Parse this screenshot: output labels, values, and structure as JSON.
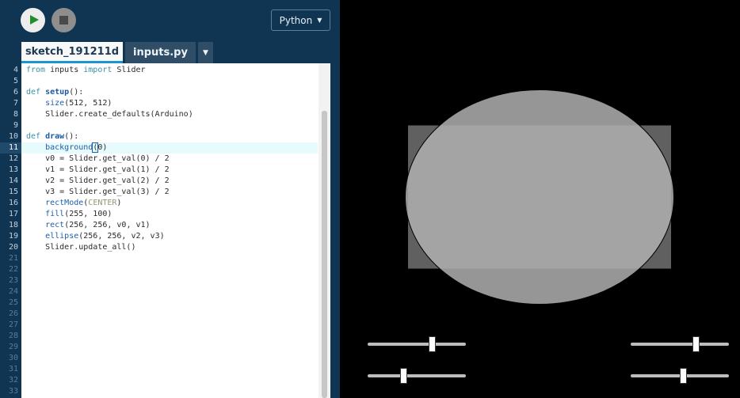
{
  "toolbar": {
    "run_icon": "play-icon",
    "stop_icon": "stop-icon",
    "mode_label": "Python",
    "mode_caret": "▼"
  },
  "tabs": [
    {
      "label": "sketch_191211d",
      "active": true
    },
    {
      "label": "inputs.py",
      "active": false
    }
  ],
  "tab_menu_caret": "▼",
  "editor": {
    "active_line": 11,
    "lines": [
      {
        "num": 4,
        "text": "from inputs import Slider"
      },
      {
        "num": 5,
        "text": ""
      },
      {
        "num": 6,
        "text": "def setup():"
      },
      {
        "num": 7,
        "text": "    size(512, 512)"
      },
      {
        "num": 8,
        "text": "    Slider.create_defaults(Arduino)"
      },
      {
        "num": 9,
        "text": ""
      },
      {
        "num": 10,
        "text": "def draw():"
      },
      {
        "num": 11,
        "text": "    background(0)"
      },
      {
        "num": 12,
        "text": "    v0 = Slider.get_val(0) / 2"
      },
      {
        "num": 13,
        "text": "    v1 = Slider.get_val(1) / 2"
      },
      {
        "num": 14,
        "text": "    v2 = Slider.get_val(2) / 2"
      },
      {
        "num": 15,
        "text": "    v3 = Slider.get_val(3) / 2"
      },
      {
        "num": 16,
        "text": "    rectMode(CENTER)"
      },
      {
        "num": 17,
        "text": "    fill(255, 100)"
      },
      {
        "num": 18,
        "text": "    rect(256, 256, v0, v1)"
      },
      {
        "num": 19,
        "text": "    ellipse(256, 256, v2, v3)"
      },
      {
        "num": 20,
        "text": "    Slider.update_all()"
      },
      {
        "num": 21,
        "text": ""
      },
      {
        "num": 22,
        "text": ""
      },
      {
        "num": 23,
        "text": ""
      },
      {
        "num": 24,
        "text": ""
      },
      {
        "num": 25,
        "text": ""
      },
      {
        "num": 26,
        "text": ""
      },
      {
        "num": 27,
        "text": ""
      },
      {
        "num": 28,
        "text": ""
      },
      {
        "num": 29,
        "text": ""
      },
      {
        "num": 30,
        "text": ""
      },
      {
        "num": 31,
        "text": ""
      },
      {
        "num": 32,
        "text": ""
      },
      {
        "num": 33,
        "text": ""
      }
    ]
  },
  "output": {
    "background": "#000000",
    "rect": {
      "width": 332,
      "height": 181
    },
    "ellipse": {
      "width": 339,
      "height": 271
    },
    "sliders": [
      {
        "name": "slider-0",
        "level": 0.65
      },
      {
        "name": "slider-1",
        "level": 0.36
      },
      {
        "name": "slider-2",
        "level": 0.66
      },
      {
        "name": "slider-3",
        "level": 0.53
      }
    ]
  },
  "colors": {
    "panel": "#0f3553",
    "accent": "#1b94d2",
    "run": "#1e8e2a"
  }
}
